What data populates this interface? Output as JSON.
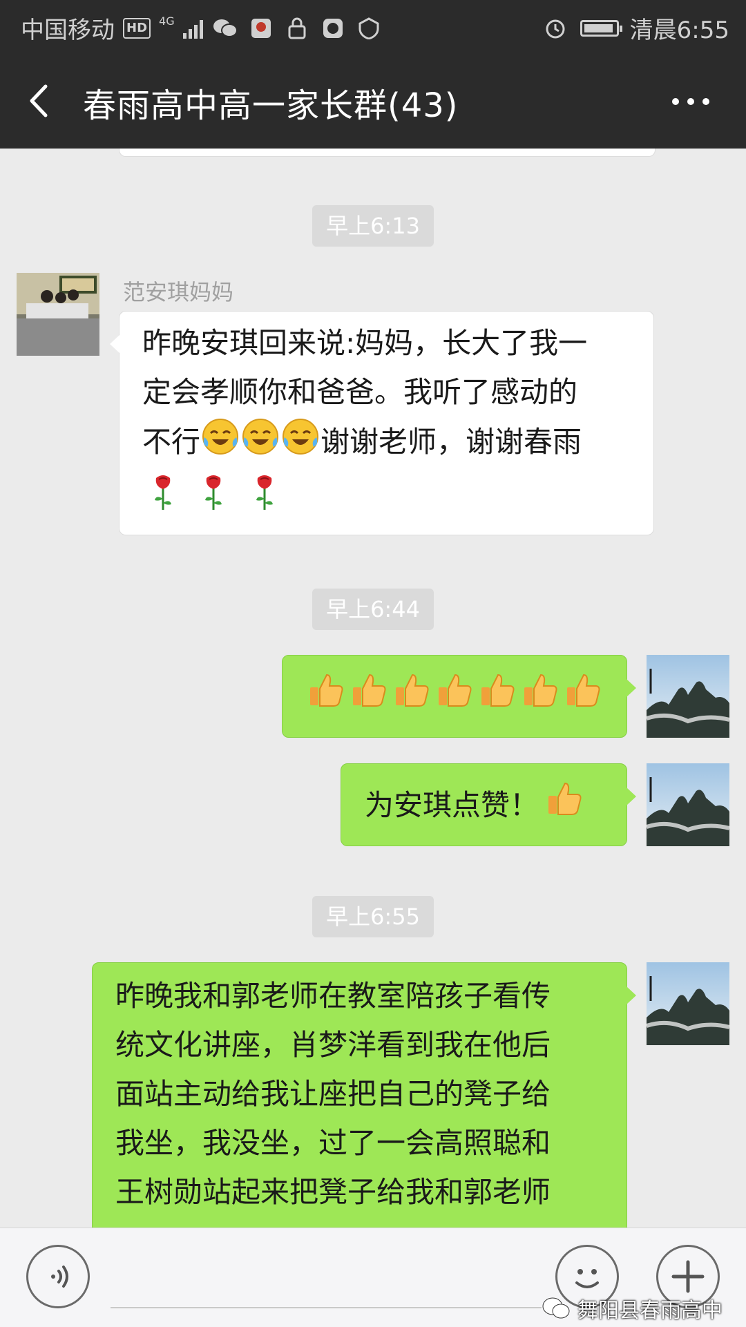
{
  "status_bar": {
    "carrier": "中国移动",
    "hd_badge": "HD",
    "network": "4G",
    "time": "清晨6:55"
  },
  "header": {
    "title": "春雨高中高一家长群(43)"
  },
  "messages": [
    {
      "type": "timestamp",
      "text": "早上6:13"
    },
    {
      "type": "incoming",
      "sender": "范安琪妈妈",
      "lines": [
        "昨晚安琪回来说:妈妈，长大了我一",
        "定会孝顺你和爸爸。我听了感动的",
        "不行",
        "谢谢老师，谢谢春雨"
      ]
    },
    {
      "type": "timestamp",
      "text": "早上6:44"
    },
    {
      "type": "outgoing",
      "emoji": "thumbs-up x7"
    },
    {
      "type": "outgoing",
      "text": "为安琪点赞！"
    },
    {
      "type": "timestamp",
      "text": "早上6:55"
    },
    {
      "type": "outgoing",
      "lines": [
        "昨晚我和郭老师在教室陪孩子看传",
        "统文化讲座，肖梦洋看到我在他后",
        "面站主动给我让座把自己的凳子给",
        "我坐，我没坐，过了一会高照聪和",
        "王树勋站起来把凳子给我和郭老师"
      ]
    }
  ],
  "input_bar": {
    "placeholder": ""
  },
  "watermark": "舞阳县春雨高中",
  "colors": {
    "header_bg": "#2b2b2b",
    "chat_bg": "#ebebeb",
    "outgoing_bubble": "#9ee756",
    "incoming_bubble": "#ffffff"
  },
  "icons": [
    "back-arrow-icon",
    "more-icon",
    "voice-icon",
    "emoji-icon",
    "plus-icon",
    "thumbs-up-icon",
    "crying-laughing-icon",
    "rose-icon",
    "alarm-icon",
    "battery-icon",
    "wechat-logo-icon"
  ]
}
